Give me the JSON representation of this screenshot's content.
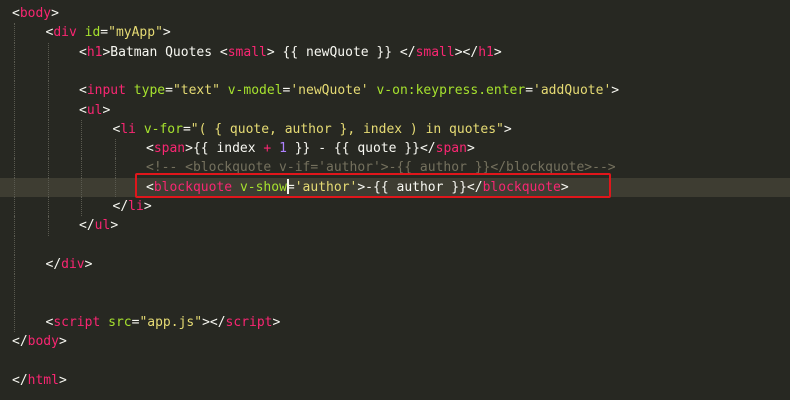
{
  "lines": [
    {
      "indent": 0,
      "tokens": [
        {
          "text": "<",
          "cls": "p"
        },
        {
          "text": "body",
          "cls": "t"
        },
        {
          "text": ">",
          "cls": "p"
        }
      ]
    },
    {
      "indent": 1,
      "tokens": [
        {
          "text": "<",
          "cls": "p"
        },
        {
          "text": "div",
          "cls": "t"
        },
        {
          "text": " ",
          "cls": "p"
        },
        {
          "text": "id",
          "cls": "a"
        },
        {
          "text": "=",
          "cls": "p"
        },
        {
          "text": "\"myApp\"",
          "cls": "s"
        },
        {
          "text": ">",
          "cls": "p"
        }
      ]
    },
    {
      "indent": 2,
      "tokens": [
        {
          "text": "<",
          "cls": "p"
        },
        {
          "text": "h1",
          "cls": "t"
        },
        {
          "text": ">Batman Quotes <",
          "cls": "p"
        },
        {
          "text": "small",
          "cls": "t"
        },
        {
          "text": "> {{ newQuote }} </",
          "cls": "p"
        },
        {
          "text": "small",
          "cls": "t"
        },
        {
          "text": "></",
          "cls": "p"
        },
        {
          "text": "h1",
          "cls": "t"
        },
        {
          "text": ">",
          "cls": "p"
        }
      ]
    },
    {
      "indent": 2,
      "tokens": []
    },
    {
      "indent": 2,
      "tokens": [
        {
          "text": "<",
          "cls": "p"
        },
        {
          "text": "input",
          "cls": "t"
        },
        {
          "text": " ",
          "cls": "p"
        },
        {
          "text": "type",
          "cls": "a"
        },
        {
          "text": "=",
          "cls": "p"
        },
        {
          "text": "\"text\"",
          "cls": "s"
        },
        {
          "text": " ",
          "cls": "p"
        },
        {
          "text": "v-model",
          "cls": "a"
        },
        {
          "text": "=",
          "cls": "p"
        },
        {
          "text": "'newQuote'",
          "cls": "s"
        },
        {
          "text": " ",
          "cls": "p"
        },
        {
          "text": "v-on:keypress.enter",
          "cls": "a"
        },
        {
          "text": "=",
          "cls": "p"
        },
        {
          "text": "'addQuote'",
          "cls": "s"
        },
        {
          "text": ">",
          "cls": "p"
        }
      ]
    },
    {
      "indent": 2,
      "tokens": [
        {
          "text": "<",
          "cls": "p"
        },
        {
          "text": "ul",
          "cls": "t"
        },
        {
          "text": ">",
          "cls": "p"
        }
      ]
    },
    {
      "indent": 3,
      "tokens": [
        {
          "text": "<",
          "cls": "p"
        },
        {
          "text": "li",
          "cls": "t"
        },
        {
          "text": " ",
          "cls": "p"
        },
        {
          "text": "v-for",
          "cls": "a"
        },
        {
          "text": "=",
          "cls": "p"
        },
        {
          "text": "\"( { quote, author }, index ) in quotes\"",
          "cls": "s"
        },
        {
          "text": ">",
          "cls": "p"
        }
      ]
    },
    {
      "indent": 4,
      "tokens": [
        {
          "text": "<",
          "cls": "p"
        },
        {
          "text": "span",
          "cls": "t"
        },
        {
          "text": ">{{ index ",
          "cls": "p"
        },
        {
          "text": "+",
          "cls": "o"
        },
        {
          "text": " ",
          "cls": "p"
        },
        {
          "text": "1",
          "cls": "n"
        },
        {
          "text": " }} - {{ quote }}</",
          "cls": "p"
        },
        {
          "text": "span",
          "cls": "t"
        },
        {
          "text": ">",
          "cls": "p"
        }
      ]
    },
    {
      "indent": 4,
      "tokens": [
        {
          "text": "<!-- <blockquote v-if='author'>-{{ author }}</blockquote>-->",
          "cls": "c"
        }
      ]
    },
    {
      "indent": 4,
      "active": true,
      "tokens": [
        {
          "text": "<",
          "cls": "p"
        },
        {
          "text": "blockquote",
          "cls": "t"
        },
        {
          "text": " ",
          "cls": "p"
        },
        {
          "text": "v-show",
          "cls": "a"
        },
        {
          "cursor": true
        },
        {
          "text": "=",
          "cls": "p"
        },
        {
          "text": "'author'",
          "cls": "s"
        },
        {
          "text": ">-{{ author }}</",
          "cls": "p"
        },
        {
          "text": "blockquote",
          "cls": "t"
        },
        {
          "text": ">",
          "cls": "p"
        }
      ]
    },
    {
      "indent": 3,
      "tokens": [
        {
          "text": "</",
          "cls": "p"
        },
        {
          "text": "li",
          "cls": "t"
        },
        {
          "text": ">",
          "cls": "p"
        }
      ]
    },
    {
      "indent": 2,
      "tokens": [
        {
          "text": "</",
          "cls": "p"
        },
        {
          "text": "ul",
          "cls": "t"
        },
        {
          "text": ">",
          "cls": "p"
        }
      ]
    },
    {
      "indent": 1,
      "tokens": []
    },
    {
      "indent": 1,
      "tokens": [
        {
          "text": "</",
          "cls": "p"
        },
        {
          "text": "div",
          "cls": "t"
        },
        {
          "text": ">",
          "cls": "p"
        }
      ]
    },
    {
      "indent": 1,
      "tokens": []
    },
    {
      "indent": 1,
      "tokens": []
    },
    {
      "indent": 1,
      "tokens": [
        {
          "text": "<",
          "cls": "p"
        },
        {
          "text": "script",
          "cls": "t"
        },
        {
          "text": " ",
          "cls": "p"
        },
        {
          "text": "src",
          "cls": "a"
        },
        {
          "text": "=",
          "cls": "p"
        },
        {
          "text": "\"app.js\"",
          "cls": "s"
        },
        {
          "text": "></",
          "cls": "p"
        },
        {
          "text": "script",
          "cls": "t"
        },
        {
          "text": ">",
          "cls": "p"
        }
      ]
    },
    {
      "indent": 0,
      "tokens": [
        {
          "text": "</",
          "cls": "p"
        },
        {
          "text": "body",
          "cls": "t"
        },
        {
          "text": ">",
          "cls": "p"
        }
      ]
    },
    {
      "indent": 0,
      "tokens": []
    },
    {
      "indent": 0,
      "tokens": [
        {
          "text": "</",
          "cls": "p"
        },
        {
          "text": "html",
          "cls": "t"
        },
        {
          "text": ">",
          "cls": "p"
        }
      ]
    }
  ],
  "colors": {
    "background": "#272822",
    "tag": "#f92672",
    "attribute": "#a6e22e",
    "string": "#e6db74",
    "text": "#f8f8f2",
    "number": "#ae81ff",
    "comment": "#75715e",
    "highlight_box": "#e0161b"
  }
}
